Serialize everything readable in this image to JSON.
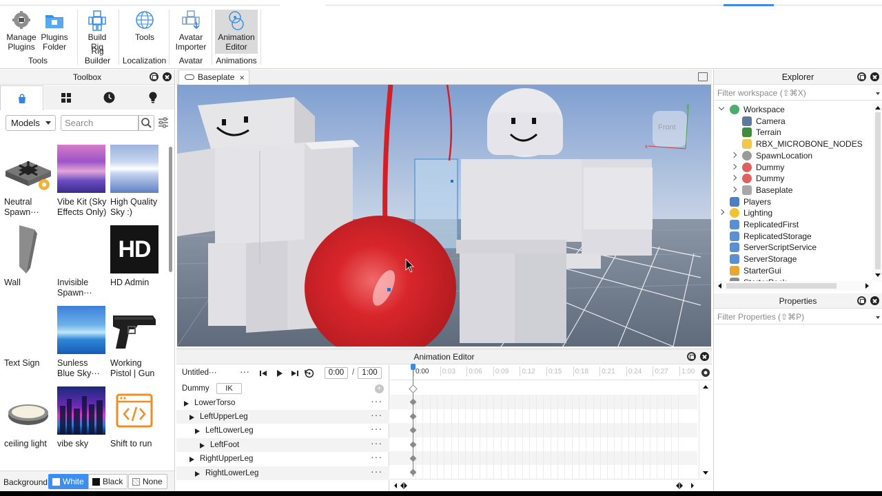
{
  "ribbon": {
    "groups": [
      {
        "label": "Tools",
        "buttons": [
          {
            "label": "Manage\nPlugins",
            "icon": "manage-plugins-icon"
          },
          {
            "label": "Plugins\nFolder",
            "icon": "plugins-folder-icon"
          }
        ]
      },
      {
        "label": "Rig Builder",
        "buttons": [
          {
            "label": "Build\nRig",
            "icon": "build-rig-icon"
          }
        ]
      },
      {
        "label": "Localization",
        "buttons": [
          {
            "label": "Tools",
            "icon": "localization-globe-icon"
          }
        ]
      },
      {
        "label": "Avatar",
        "buttons": [
          {
            "label": "Avatar\nImporter",
            "icon": "avatar-importer-icon"
          }
        ]
      },
      {
        "label": "Animations",
        "buttons": [
          {
            "label": "Animation\nEditor",
            "icon": "animation-editor-icon",
            "active": true
          }
        ]
      }
    ]
  },
  "toolbox": {
    "title": "Toolbox",
    "tabs": [
      "bag-icon",
      "grid-icon",
      "clock-icon",
      "bulb-icon"
    ],
    "filter": "Models",
    "search_placeholder": "Search",
    "items": [
      {
        "name": "Neutral\nSpawn···",
        "thumb": "spawn"
      },
      {
        "name": "Vibe Kit (Sky\nEffects Only)",
        "thumb": "sky-purple"
      },
      {
        "name": "High Quality\nSky :)",
        "thumb": "sky-blue"
      },
      {
        "name": "Wall",
        "thumb": "wall"
      },
      {
        "name": "Invisible\nSpawn···",
        "thumb": "none"
      },
      {
        "name": "HD Admin",
        "thumb": "hd",
        "thumb_text": "HD"
      },
      {
        "name": "Text Sign",
        "thumb": "none"
      },
      {
        "name": "Sunless\nBlue Sky···",
        "thumb": "sky-sunless"
      },
      {
        "name": "Working\nPistol | Gun",
        "thumb": "pistol"
      },
      {
        "name": "ceiling light",
        "thumb": "light"
      },
      {
        "name": "vibe sky",
        "thumb": "city"
      },
      {
        "name": "Shift to run",
        "thumb": "code"
      }
    ],
    "background_label": "Background:",
    "background_options": [
      {
        "label": "White",
        "selected": true,
        "swatch": "#ffffff"
      },
      {
        "label": "Black",
        "selected": false,
        "swatch": "#111111"
      },
      {
        "label": "None",
        "selected": false,
        "swatch": "none"
      }
    ]
  },
  "viewport": {
    "tab_label": "Baseplate",
    "tab_close": "×",
    "view_cube_label": "Front"
  },
  "animation_editor": {
    "title": "Animation Editor",
    "animation_name": "Untitled···",
    "menu_dots": "···",
    "current_time": "0:00",
    "time_separator": "/",
    "end_time": "1:00",
    "rig_name": "Dummy",
    "ik_label": "IK",
    "ruler_ticks": [
      "0:00",
      "0:03",
      "0:06",
      "0:09",
      "0:12",
      "0:15",
      "0:18",
      "0:21",
      "0:24",
      "0:27",
      "1:00"
    ],
    "tracks": [
      {
        "name": "LowerTorso",
        "indent": 0
      },
      {
        "name": "LeftUpperLeg",
        "indent": 1
      },
      {
        "name": "LeftLowerLeg",
        "indent": 2
      },
      {
        "name": "LeftFoot",
        "indent": 3
      },
      {
        "name": "RightUpperLeg",
        "indent": 1
      },
      {
        "name": "RightLowerLeg",
        "indent": 2
      }
    ]
  },
  "explorer": {
    "title": "Explorer",
    "filter_placeholder": "Filter workspace (⇧⌘X)",
    "tree": [
      {
        "label": "Workspace",
        "depth": 0,
        "expander": "open",
        "icon": "workspace-icon"
      },
      {
        "label": "Camera",
        "depth": 1,
        "expander": "none",
        "icon": "camera-icon"
      },
      {
        "label": "Terrain",
        "depth": 1,
        "expander": "none",
        "icon": "terrain-icon"
      },
      {
        "label": "RBX_MICROBONE_NODES",
        "depth": 1,
        "expander": "none",
        "icon": "folder-icon"
      },
      {
        "label": "SpawnLocation",
        "depth": 1,
        "expander": "closed",
        "icon": "spawn-location-icon"
      },
      {
        "label": "Dummy",
        "depth": 1,
        "expander": "closed",
        "icon": "model-icon"
      },
      {
        "label": "Dummy",
        "depth": 1,
        "expander": "closed",
        "icon": "model-icon"
      },
      {
        "label": "Baseplate",
        "depth": 1,
        "expander": "closed",
        "icon": "part-icon"
      },
      {
        "label": "Players",
        "depth": 0,
        "expander": "none",
        "icon": "players-icon"
      },
      {
        "label": "Lighting",
        "depth": 0,
        "expander": "closed",
        "icon": "lighting-icon"
      },
      {
        "label": "ReplicatedFirst",
        "depth": 0,
        "expander": "none",
        "icon": "replicated-first-icon"
      },
      {
        "label": "ReplicatedStorage",
        "depth": 0,
        "expander": "none",
        "icon": "replicated-storage-icon"
      },
      {
        "label": "ServerScriptService",
        "depth": 0,
        "expander": "none",
        "icon": "server-script-service-icon"
      },
      {
        "label": "ServerStorage",
        "depth": 0,
        "expander": "none",
        "icon": "server-storage-icon"
      },
      {
        "label": "StarterGui",
        "depth": 0,
        "expander": "none",
        "icon": "starter-gui-icon"
      },
      {
        "label": "StarterPack",
        "depth": 0,
        "expander": "none",
        "icon": "starter-pack-icon"
      }
    ]
  },
  "properties": {
    "title": "Properties",
    "filter_placeholder": "Filter Properties (⇧⌘P)"
  },
  "colors": {
    "accent": "#3b8ff0",
    "panel_header": "#f3f3f3",
    "balloon_red": "#d8262b"
  }
}
